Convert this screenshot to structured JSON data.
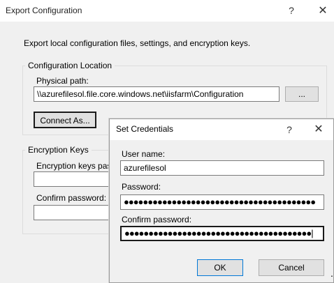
{
  "export_dialog": {
    "title": "Export Configuration",
    "help": "?",
    "close": "✕",
    "description": "Export local configuration files, settings, and encryption keys.",
    "config_location": {
      "legend": "Configuration Location",
      "physical_path_label": "Physical path:",
      "physical_path_value": "\\\\azurefilesol.file.core.windows.net\\iisfarm\\Configuration",
      "browse_label": "...",
      "connect_label": "Connect As..."
    },
    "encryption_keys": {
      "legend": "Encryption Keys",
      "password_label": "Encryption keys password:",
      "password_value": "",
      "confirm_label": "Confirm password:",
      "confirm_value": ""
    }
  },
  "credentials_dialog": {
    "title": "Set Credentials",
    "help": "?",
    "close": "✕",
    "user_label": "User name:",
    "user_value": "azurefilesol",
    "password_label": "Password:",
    "password_value": "●●●●●●●●●●●●●●●●●●●●●●●●●●●●●●●●●●●●●●●●",
    "confirm_label": "Confirm password:",
    "confirm_value": "●●●●●●●●●●●●●●●●●●●●●●●●●●●●●●●●●●●●●●●|",
    "ok_label": "OK",
    "cancel_label": "Cancel"
  },
  "trailing_mark": "."
}
